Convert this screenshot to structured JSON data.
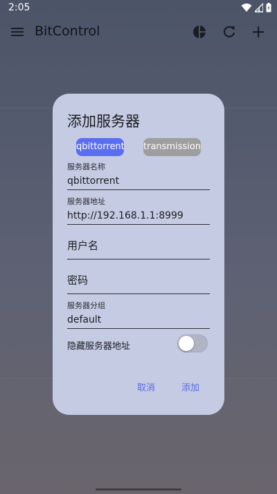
{
  "status_bar": {
    "time": "2:05",
    "icons": [
      "wifi-icon",
      "signal-icon",
      "battery-icon"
    ]
  },
  "app_bar": {
    "title": "BitControl",
    "actions": [
      "chart-icon",
      "refresh-icon",
      "add-icon"
    ]
  },
  "dialog": {
    "title": "添加服务器",
    "chips": [
      {
        "label": "qbittorrent",
        "selected": true
      },
      {
        "label": "transmission",
        "selected": false
      }
    ],
    "fields": {
      "server_name": {
        "label": "服务器名称",
        "value": "qbittorrent"
      },
      "server_address": {
        "label": "服务器地址",
        "value": "http://192.168.1.1:8999"
      },
      "username": {
        "placeholder": "用户名"
      },
      "password": {
        "placeholder": "密码"
      },
      "server_group": {
        "label": "服务器分组",
        "value": "default"
      }
    },
    "hide_address": {
      "label": "隐藏服务器地址",
      "enabled": false
    },
    "buttons": {
      "cancel": "取消",
      "add": "添加"
    }
  },
  "colors": {
    "accent": "#5b6ef0",
    "dialog_bg": "#c6cbe4",
    "chip_unselected": "#9e9e9e",
    "button_text": "#5669e6"
  }
}
